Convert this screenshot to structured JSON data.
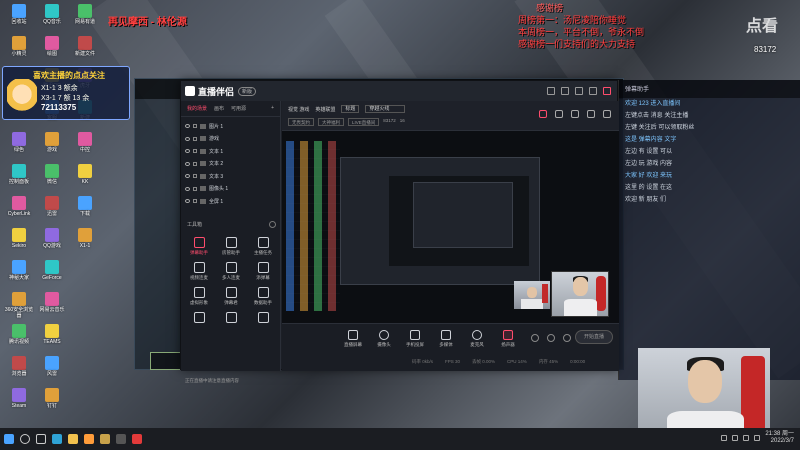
{
  "stream_title": "再见摩西 - 林伦源",
  "notice": {
    "heading": "感谢榜",
    "lines": [
      "周榜第一：汤尼凌陪你睡觉",
      "本周榜一，平台不倒，爷永不倒",
      "感谢榜一们支持们的大力支持"
    ]
  },
  "viewer_count": "83172",
  "corner_logo": "点看",
  "overlay_sign": {
    "title": "喜欢主播的点点关注",
    "line1": "X1-1 3 额余",
    "line2": "X3-1 7 额 13 余",
    "id_label": "72113375"
  },
  "app": {
    "name": "直播伴侣",
    "badge": "新版",
    "scene_tabs": [
      "我的场景",
      "画布",
      "可用源"
    ],
    "sources": [
      "图片 1",
      "游戏",
      "文本 1",
      "文本 2",
      "文本 3",
      "图像头 1",
      "全屏 1"
    ],
    "tools_label": "工具箱",
    "tools": [
      "弹幕助手",
      "房管助手",
      "主播任务",
      "视频连麦",
      "多人连麦",
      "添弹幕",
      "虚拟形象",
      "弹幕君",
      "数据助手",
      "",
      "",
      ""
    ],
    "notice_text": "正在直播中请注意直播内容",
    "meta": {
      "category": "视觉 游戏",
      "type": "英雄联盟",
      "title_label": "标题",
      "game": "穿越火线",
      "pill1": "无畏契约",
      "pill2": "大神福利",
      "pill3": "LIVE直播间",
      "room_id": "83172",
      "fans": "16"
    },
    "controls": [
      "直播屏幕",
      "摄像头",
      "手机投屏",
      "多媒体",
      "麦克风",
      "扬声器"
    ],
    "go_live": "开始直播",
    "stats": [
      "码率 0kb/s",
      "FPS 30",
      "丢帧 0.00%",
      "CPU 14%",
      "内存 45%",
      "0:00:00"
    ]
  },
  "chat": {
    "header": "弹幕助手",
    "lines": [
      "欢迎 123 进入直播间",
      "左键点击 消息 关注主播",
      "左键 关注后 可以领取粉丝",
      "这是 弹幕内容 文字",
      "左边 有 设置 可以",
      "左边 玩 游戏 内容",
      "大家 好 欢迎 来玩",
      "这里 的 设置 在这",
      "欢迎 新 朋友 们"
    ]
  },
  "taskbar": {
    "time": "21:38 周一",
    "date": "2022/3/7"
  },
  "desktop_icons": [
    "回收站",
    "小精灵",
    "火绒",
    "DSF",
    "绿色",
    "控制面板",
    "CyberLink",
    "Sekiro",
    "神秘大家",
    "360安全浏览器",
    "腾讯视频",
    "浏览器",
    "Steam",
    "QQ音乐",
    "绘图",
    "腾讯QQ",
    "客服",
    "游戏",
    "微信",
    "迅雷",
    "QQ游戏",
    "GeForce",
    "网易云音乐",
    "TEAMS",
    "风雷",
    "钉钉",
    "网易有道",
    "新建文件",
    "虎牙",
    "新建",
    "中控",
    "KK",
    "下载",
    "X1-1"
  ]
}
